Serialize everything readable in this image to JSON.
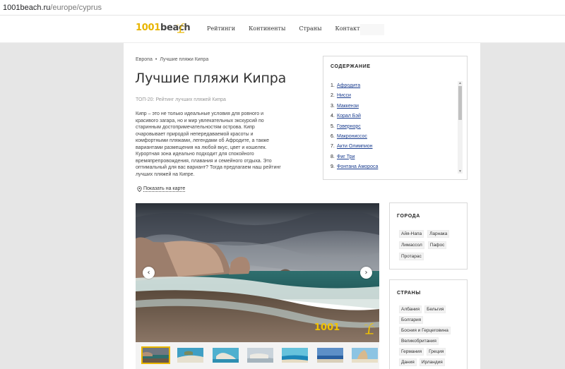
{
  "browser": {
    "url_host": "1001beach.ru",
    "url_path": "/europe/cyprus"
  },
  "header": {
    "logo_num": "1001",
    "logo_word": "beach",
    "nav": [
      "Рейтинги",
      "Континенты",
      "Страны",
      "Контакты"
    ]
  },
  "breadcrumb": {
    "parent": "Европа",
    "current": "Лучшие пляжи Кипра"
  },
  "title": "Лучшие пляжи Кипра",
  "subtitle": "ТОП-20: Рейтинг лучших пляжей Кипра",
  "intro": "Кипр – это не только идеальные условия для ровного и красивого загара, но и мир увлекательных экскурсий по старинным достопримечательностям острова. Кипр очаровывает природой непередаваемой красоты и комфортными пляжами, легендами об Афродите, а также вариантами размещения на любой вкус, цвет и кошелек. Курортная зона идеально подходит для спокойного времяпрепровождения, плавания и семейного отдыха. Это оптимальный для вас вариант? Тогда предлагаем наш рейтинг лучших пляжей на Кипре.",
  "map_link": "Показать на карте",
  "toc": {
    "title": "СОДЕРЖАНИЕ",
    "items": [
      {
        "num": "1.",
        "label": "Афродита"
      },
      {
        "num": "2.",
        "label": "Нисси"
      },
      {
        "num": "3.",
        "label": "Маккензи"
      },
      {
        "num": "4.",
        "label": "Корал Бэй"
      },
      {
        "num": "5.",
        "label": "Говернорс"
      },
      {
        "num": "6.",
        "label": "Макрониссос"
      },
      {
        "num": "7.",
        "label": "Акти Олимпион"
      },
      {
        "num": "8.",
        "label": "Фиг Три"
      },
      {
        "num": "9.",
        "label": "Фонтана Амороса"
      }
    ]
  },
  "gallery": {
    "watermark": "1001",
    "thumb_count": 7,
    "active_thumb": 1
  },
  "cities": {
    "title": "ГОРОДА",
    "items": [
      "Айя-Напа",
      "Ларнака",
      "Лимассол",
      "Пафос",
      "Протарас"
    ]
  },
  "countries": {
    "title": "СТРАНЫ",
    "items": [
      "Албания",
      "Бельгия",
      "Болгария",
      "Босния и Герцеговина",
      "Великобритания",
      "Германия",
      "Греция",
      "Дания",
      "Ирландия"
    ]
  },
  "colors": {
    "brand": "#e8b500",
    "link": "#1a3d8f",
    "page_bg": "#e6e6e6"
  }
}
